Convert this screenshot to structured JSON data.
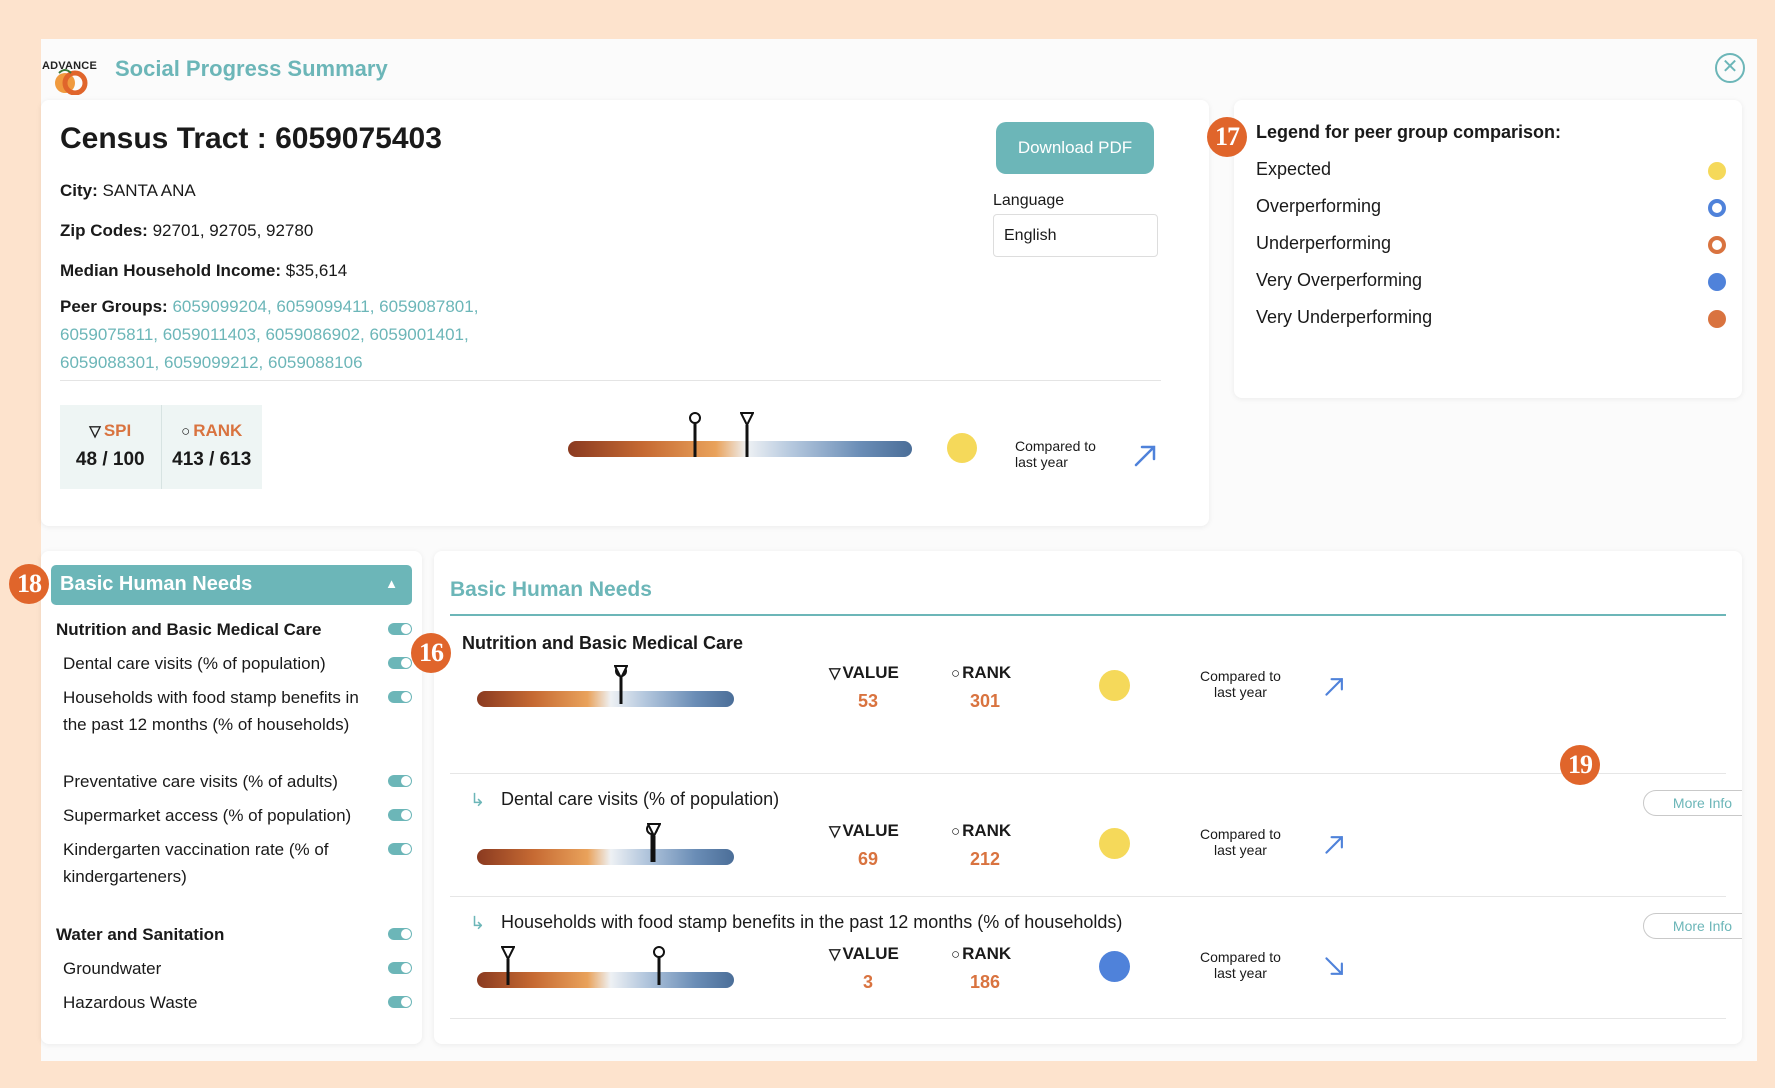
{
  "header": {
    "logo_text": "ADVANCE",
    "title": "Social Progress Summary",
    "close_icon": "close-circle-icon"
  },
  "info": {
    "tract_title": "Census Tract : 6059075403",
    "city_label": "City:",
    "city_value": "SANTA ANA",
    "zip_label": "Zip Codes:",
    "zip_value": "92701, 92705, 92780",
    "income_label": "Median Household Income:",
    "income_value": "$35,614",
    "peer_label": "Peer Groups:",
    "peer_value": "6059099204, 6059099411, 6059087801, 6059075811, 6059011403, 6059086902, 6059001401, 6059088301, 6059099212, 6059088106",
    "download_label": "Download PDF",
    "language_label": "Language",
    "language_value": "English",
    "spi_symbol": "▽",
    "spi_label": "SPI",
    "spi_value": "48 / 100",
    "rank_symbol": "○",
    "rank_label": "RANK",
    "rank_value": "413 / 613",
    "compared_line1": "Compared to",
    "compared_line2": "last year",
    "status": "Expected",
    "trend": "up",
    "spi_pct": 0.52,
    "rank_pct": 0.37
  },
  "legend": {
    "title": "Legend for peer group comparison:",
    "items": [
      {
        "label": "Expected",
        "color": "#f5d95a",
        "style": "filled"
      },
      {
        "label": "Overperforming",
        "color": "#4f82da",
        "style": "ring"
      },
      {
        "label": "Underperforming",
        "color": "#d9733f",
        "style": "ring"
      },
      {
        "label": "Very Overperforming",
        "color": "#4f82da",
        "style": "filled"
      },
      {
        "label": "Very Underperforming",
        "color": "#d9733f",
        "style": "filled"
      }
    ]
  },
  "badges": {
    "b16": "16",
    "b17": "17",
    "b18": "18",
    "b19": "19"
  },
  "sidebar": {
    "header": "Basic Human Needs",
    "items": [
      {
        "label": "Nutrition and Basic Medical Care",
        "bold": true
      },
      {
        "label": "Dental care visits (% of population)",
        "bold": false
      },
      {
        "label": "Households with food stamp benefits in the past 12 months (% of households)",
        "bold": false
      },
      {
        "label": "Preventative care visits (% of adults)",
        "bold": false
      },
      {
        "label": "Supermarket access (% of population)",
        "bold": false
      },
      {
        "label": "Kindergarten vaccination rate (% of kindergarteners)",
        "bold": false
      },
      {
        "label": "Water and Sanitation",
        "bold": true
      },
      {
        "label": "Groundwater",
        "bold": false
      },
      {
        "label": "Hazardous Waste",
        "bold": false
      }
    ]
  },
  "detail": {
    "title": "Basic Human Needs",
    "value_symbol": "▽",
    "value_label": "VALUE",
    "rank_symbol": "○",
    "rank_label": "RANK",
    "compared_line1": "Compared to",
    "compared_line2": "last year",
    "more_info": "More Info",
    "subcategory": "Nutrition and Basic Medical Care",
    "rows": [
      {
        "label": "Nutrition and Basic Medical Care",
        "value": "53",
        "rank": "301",
        "status": "Expected",
        "trend": "up",
        "value_pct": 0.56,
        "rank_pct": 0.56
      },
      {
        "label": "Dental care visits (% of population)",
        "value": "69",
        "rank": "212",
        "status": "Expected",
        "trend": "up",
        "value_pct": 0.69,
        "rank_pct": 0.68
      },
      {
        "label": "Households with food stamp benefits in the past 12 months (% of households)",
        "value": "3",
        "rank": "186",
        "status": "Very Overperforming",
        "trend": "down",
        "value_pct": 0.12,
        "rank_pct": 0.71
      }
    ]
  }
}
